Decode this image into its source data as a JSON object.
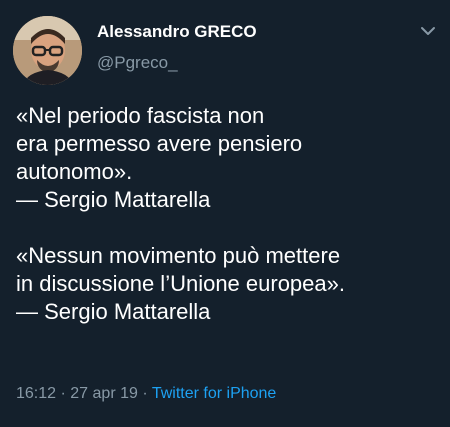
{
  "author": {
    "display_name": "Alessandro GRECO",
    "handle": "@Pgreco_"
  },
  "tweet": {
    "lines_quote1": [
      "«Nel periodo fascista non",
      "era permesso avere pensiero",
      "autonomo».",
      "— Sergio Mattarella"
    ],
    "lines_quote2": [
      "«Nessun movimento può mettere",
      "in discussione l’Unione europea».",
      "— Sergio Mattarella"
    ],
    "time": "16:12",
    "separator": "·",
    "date": "27 apr 19",
    "source": "Twitter for iPhone"
  },
  "icons": {
    "menu": "chevron-down-icon"
  },
  "colors": {
    "background": "#14202c",
    "text": "#ffffff",
    "muted": "#8899a6",
    "link": "#1da1f2"
  }
}
